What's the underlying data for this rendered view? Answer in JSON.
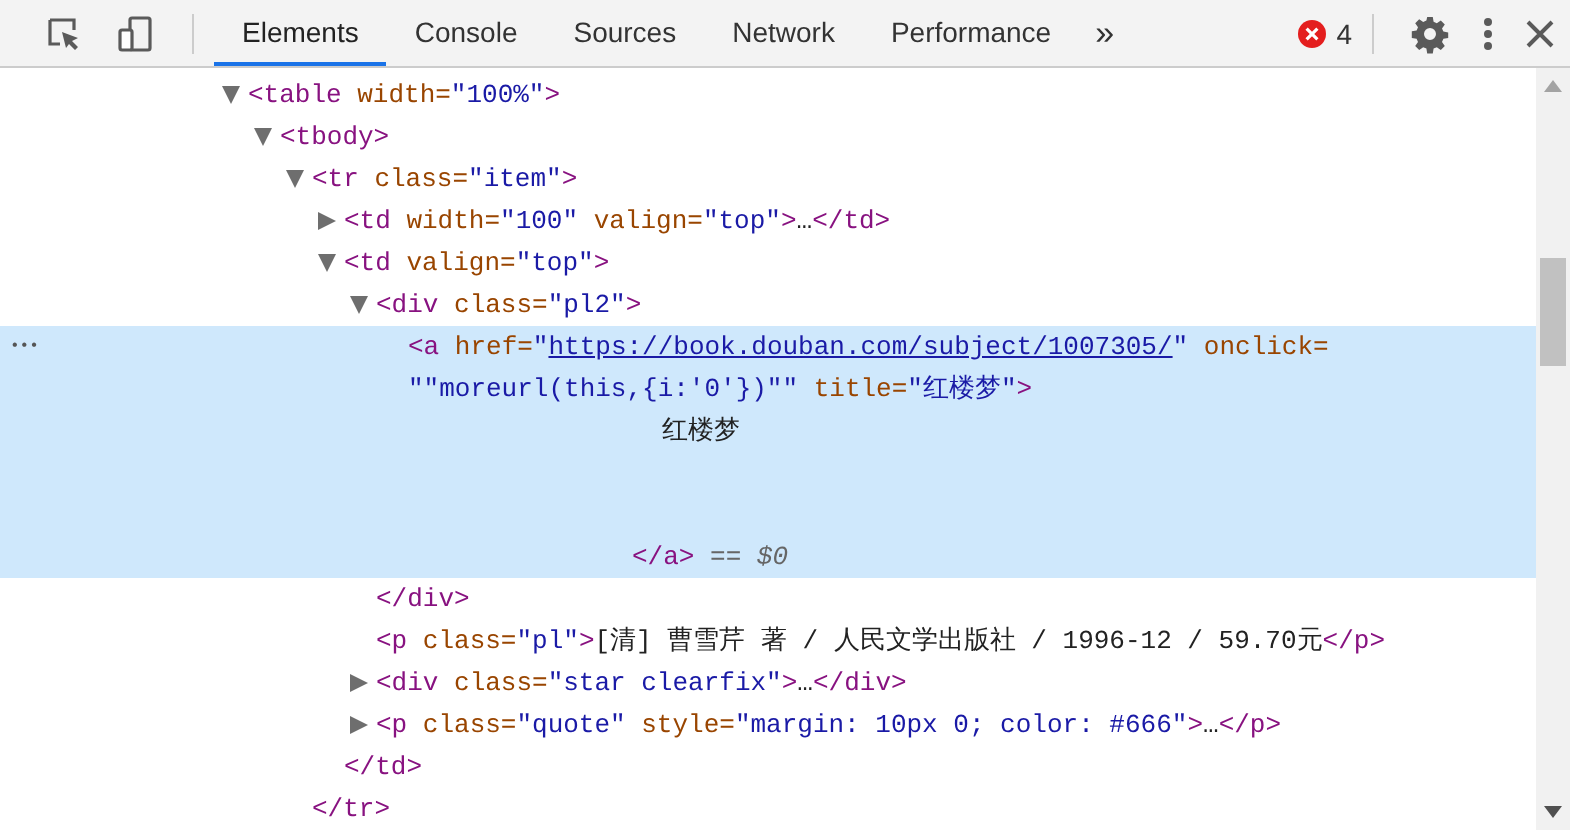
{
  "toolbar": {
    "tabs": [
      {
        "label": "Elements",
        "selected": true
      },
      {
        "label": "Console",
        "selected": false
      },
      {
        "label": "Sources",
        "selected": false
      },
      {
        "label": "Network",
        "selected": false
      },
      {
        "label": "Performance",
        "selected": false
      }
    ],
    "overflow": "»",
    "error_count": "4"
  },
  "dom_tree": [
    {
      "expanded": true,
      "selected": false,
      "lines": [
        {
          "tokens": [
            {
              "kind": "tag",
              "text": "<table"
            },
            {
              "kind": "attr",
              "text": " width="
            },
            {
              "kind": "value",
              "text": "\"100%\""
            },
            {
              "kind": "tag",
              "text": ">"
            }
          ]
        }
      ],
      "children": [
        {
          "expanded": true,
          "selected": false,
          "lines": [
            {
              "tokens": [
                {
                  "kind": "tag",
                  "text": "<tbody>"
                }
              ]
            }
          ],
          "children": [
            {
              "expanded": true,
              "selected": false,
              "lines": [
                {
                  "tokens": [
                    {
                      "kind": "tag",
                      "text": "<tr"
                    },
                    {
                      "kind": "attr",
                      "text": " class="
                    },
                    {
                      "kind": "value",
                      "text": "\"item\""
                    },
                    {
                      "kind": "tag",
                      "text": ">"
                    }
                  ]
                }
              ],
              "children": [
                {
                  "expanded": false,
                  "selected": false,
                  "lines": [
                    {
                      "tokens": [
                        {
                          "kind": "tag",
                          "text": "<td"
                        },
                        {
                          "kind": "attr",
                          "text": " width="
                        },
                        {
                          "kind": "value",
                          "text": "\"100\""
                        },
                        {
                          "kind": "attr",
                          "text": " valign="
                        },
                        {
                          "kind": "value",
                          "text": "\"top\""
                        },
                        {
                          "kind": "tag",
                          "text": ">"
                        },
                        {
                          "kind": "text",
                          "text": "…"
                        },
                        {
                          "kind": "tag",
                          "text": "</td>"
                        }
                      ]
                    }
                  ]
                },
                {
                  "expanded": true,
                  "selected": false,
                  "lines": [
                    {
                      "tokens": [
                        {
                          "kind": "tag",
                          "text": "<td"
                        },
                        {
                          "kind": "attr",
                          "text": " valign="
                        },
                        {
                          "kind": "value",
                          "text": "\"top\""
                        },
                        {
                          "kind": "tag",
                          "text": ">"
                        }
                      ]
                    }
                  ],
                  "children": [
                    {
                      "expanded": true,
                      "selected": false,
                      "lines": [
                        {
                          "tokens": [
                            {
                              "kind": "tag",
                              "text": "<div"
                            },
                            {
                              "kind": "attr",
                              "text": " class="
                            },
                            {
                              "kind": "value",
                              "text": "\"pl2\""
                            },
                            {
                              "kind": "tag",
                              "text": ">"
                            }
                          ]
                        }
                      ],
                      "children": [
                        {
                          "selected": true,
                          "lines": [
                            {
                              "tokens": [
                                {
                                  "kind": "tag",
                                  "text": "<a"
                                },
                                {
                                  "kind": "attr",
                                  "text": " href="
                                },
                                {
                                  "kind": "value",
                                  "text": "\""
                                },
                                {
                                  "kind": "link",
                                  "text": "https://book.douban.com/subject/1007305/"
                                },
                                {
                                  "kind": "value",
                                  "text": "\""
                                },
                                {
                                  "kind": "attr",
                                  "text": " onclick="
                                }
                              ]
                            },
                            {
                              "tokens": [
                                {
                                  "kind": "value",
                                  "text": "\"\"moreurl(this,{i:'0'})\"\""
                                },
                                {
                                  "kind": "attr",
                                  "text": " title="
                                },
                                {
                                  "kind": "value",
                                  "text": "\"红楼梦\""
                                },
                                {
                                  "kind": "tag",
                                  "text": ">"
                                }
                              ]
                            },
                            {
                              "kind": "content",
                              "tokens": [
                                {
                                  "kind": "text",
                                  "text": "红楼梦"
                                }
                              ]
                            },
                            {
                              "kind": "close",
                              "tokens": [
                                {
                                  "kind": "tag",
                                  "text": "</a>"
                                },
                                {
                                  "kind": "comment",
                                  "text": " == $0"
                                }
                              ]
                            }
                          ]
                        }
                      ]
                    },
                    {
                      "selected": false,
                      "lines": [
                        {
                          "tokens": [
                            {
                              "kind": "tag",
                              "text": "</div>"
                            }
                          ]
                        }
                      ]
                    },
                    {
                      "selected": false,
                      "lines": [
                        {
                          "tokens": [
                            {
                              "kind": "tag",
                              "text": "<p"
                            },
                            {
                              "kind": "attr",
                              "text": " class="
                            },
                            {
                              "kind": "value",
                              "text": "\"pl\""
                            },
                            {
                              "kind": "tag",
                              "text": ">"
                            },
                            {
                              "kind": "text",
                              "text": "[清] 曹雪芹 著 / 人民文学出版社 / 1996-12 / 59.70元"
                            },
                            {
                              "kind": "tag",
                              "text": "</p>"
                            }
                          ]
                        }
                      ]
                    },
                    {
                      "expanded": false,
                      "selected": false,
                      "lines": [
                        {
                          "tokens": [
                            {
                              "kind": "tag",
                              "text": "<div"
                            },
                            {
                              "kind": "attr",
                              "text": " class="
                            },
                            {
                              "kind": "value",
                              "text": "\"star clearfix\""
                            },
                            {
                              "kind": "tag",
                              "text": ">"
                            },
                            {
                              "kind": "text",
                              "text": "…"
                            },
                            {
                              "kind": "tag",
                              "text": "</div>"
                            }
                          ]
                        }
                      ]
                    },
                    {
                      "expanded": false,
                      "selected": false,
                      "lines": [
                        {
                          "tokens": [
                            {
                              "kind": "tag",
                              "text": "<p"
                            },
                            {
                              "kind": "attr",
                              "text": " class="
                            },
                            {
                              "kind": "value",
                              "text": "\"quote\""
                            },
                            {
                              "kind": "attr",
                              "text": " style="
                            },
                            {
                              "kind": "value",
                              "text": "\"margin: 10px 0; color: #666\""
                            },
                            {
                              "kind": "tag",
                              "text": ">"
                            },
                            {
                              "kind": "text",
                              "text": "…"
                            },
                            {
                              "kind": "tag",
                              "text": "</p>"
                            }
                          ]
                        }
                      ]
                    }
                  ]
                },
                {
                  "selected": false,
                  "lines": [
                    {
                      "tokens": [
                        {
                          "kind": "tag",
                          "text": "</td>"
                        }
                      ]
                    }
                  ]
                }
              ]
            },
            {
              "selected": false,
              "lines": [
                {
                  "tokens": [
                    {
                      "kind": "tag",
                      "text": "</tr>"
                    }
                  ]
                }
              ]
            }
          ]
        }
      ]
    }
  ],
  "gutter_mark": "•••"
}
